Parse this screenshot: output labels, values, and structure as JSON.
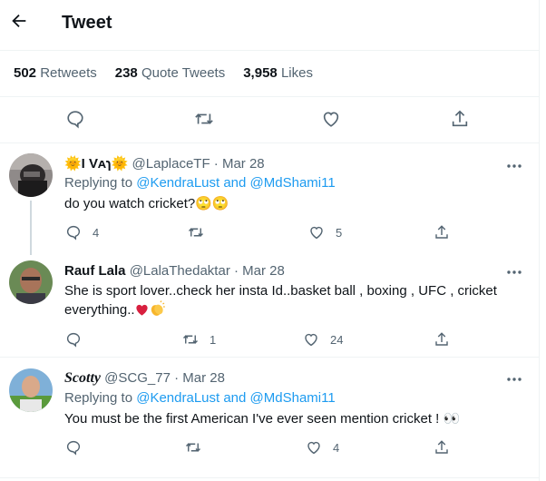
{
  "header": {
    "title": "Tweet"
  },
  "stats": {
    "retweets_count": "502",
    "retweets_label": "Retweets",
    "quotes_count": "238",
    "quotes_label": "Quote Tweets",
    "likes_count": "3,958",
    "likes_label": "Likes"
  },
  "replies": [
    {
      "name": "🌞I Vᴀɿ🌞",
      "handle": "@LaplaceTF · Mar 28",
      "replying_prefix": "Replying to ",
      "mention1": "@KendraLust",
      "and": " and ",
      "mention2": "@MdShami11",
      "text": "do you watch cricket?🙄🙄",
      "reply_count": "4",
      "retweet_count": "",
      "like_count": "5"
    },
    {
      "name": "Rauf Lala",
      "handle": "@LalaThedaktar · Mar 28",
      "text": "She is sport lover..check her insta Id..basket ball , boxing , UFC , cricket everything..",
      "reply_count": "",
      "retweet_count": "1",
      "like_count": "24"
    },
    {
      "name": "Scotty",
      "handle": "@SCG_77 · Mar 28",
      "replying_prefix": "Replying to ",
      "mention1": "@KendraLust",
      "and": " and ",
      "mention2": "@MdShami11",
      "text": "You must be the first American I've ever seen mention cricket ! 👀",
      "reply_count": "",
      "retweet_count": "",
      "like_count": "4"
    }
  ],
  "colors": {
    "accent": "#1d9bf0",
    "secondary_text": "#536471",
    "divider": "#eff3f4"
  }
}
